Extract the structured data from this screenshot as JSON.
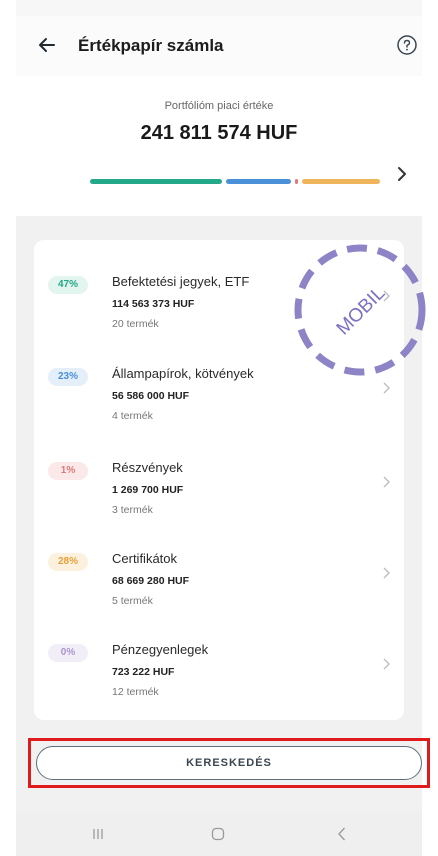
{
  "header": {
    "title": "Értékpapír számla"
  },
  "hero": {
    "label": "Portfólióm piaci értéke",
    "value": "241 811 574 HUF",
    "allocation": [
      {
        "name": "Befektetési jegyek, ETF",
        "percent": 47,
        "color": "#23a889"
      },
      {
        "name": "Állampapírok, kötvények",
        "percent": 23,
        "color": "#4a90d9"
      },
      {
        "name": "Részvények",
        "percent": 1,
        "color": "#e07a7a"
      },
      {
        "name": "Certifikátok",
        "percent": 28,
        "color": "#f0b45a"
      },
      {
        "name": "Pénzegyenlegek",
        "percent": 0,
        "color": "#b9a6d6"
      }
    ]
  },
  "categories": [
    {
      "percent": "47%",
      "name": "Befektetési jegyek, ETF",
      "value": "114 563 373 HUF",
      "count": "20 termék",
      "badge_color": "#23a889",
      "badge_bg": "#e3f5ef"
    },
    {
      "percent": "23%",
      "name": "Állampapírok, kötvények",
      "value": "56 586 000 HUF",
      "count": "4 termék",
      "badge_color": "#4a90d9",
      "badge_bg": "#e4effa"
    },
    {
      "percent": "1%",
      "name": "Részvények",
      "value": "1 269 700 HUF",
      "count": "3 termék",
      "badge_color": "#e07a7a",
      "badge_bg": "#fbe9e9"
    },
    {
      "percent": "28%",
      "name": "Certifikátok",
      "value": "68 669 280 HUF",
      "count": "5 termék",
      "badge_color": "#e6a03a",
      "badge_bg": "#fcf1df"
    },
    {
      "percent": "0%",
      "name": "Pénzegyenlegek",
      "value": "723 222 HUF",
      "count": "12 termék",
      "badge_color": "#a996cc",
      "badge_bg": "#f2eef8"
    }
  ],
  "stamp": {
    "text": "MOBIL",
    "color": "#8c84c6"
  },
  "actions": {
    "trade_label": "KERESKEDÉS",
    "highlight_color": "#e01b1b"
  },
  "icons": {
    "back": "arrow-left-icon",
    "help": "help-circle-icon",
    "chevron": "chevron-right-icon",
    "nav_recent": "recent-apps-icon",
    "nav_home": "home-icon",
    "nav_back": "nav-back-icon"
  }
}
